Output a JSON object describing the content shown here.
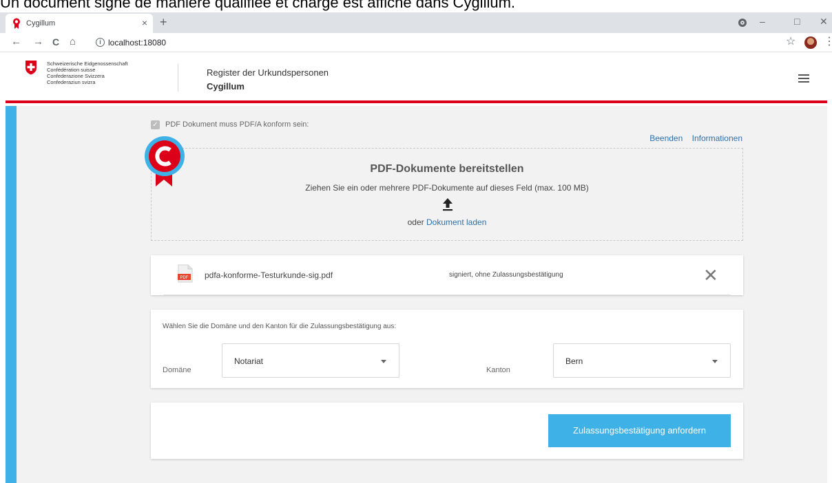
{
  "caption": "Un document signé de manière qualifiée et chargé est affiché dans Cygillum.",
  "browser": {
    "tab_title": "Cygillum",
    "tab_close": "×",
    "new_tab": "+",
    "url": "localhost:18080",
    "nav": {
      "back": "←",
      "forward": "→",
      "reload": "C",
      "home": "⌂"
    },
    "info_glyph": "i",
    "star": "☆",
    "menu": "⋮",
    "window": {
      "minimize": "–",
      "maximize": "□",
      "close": "✕"
    },
    "icons": [
      "cygillum-favicon-icon",
      "extension-icon",
      "star-icon",
      "profile-avatar-icon",
      "kebab-menu-icon"
    ]
  },
  "header": {
    "federal_lines": [
      "Schweizerische Eidgenossenschaft",
      "Confédération suisse",
      "Confederazione Svizzera",
      "Confederaziun svizra"
    ],
    "register_title": "Register der Urkundspersonen",
    "app_name": "Cygillum",
    "accent_color": "#dc0018"
  },
  "options": {
    "pdfa_checkbox_label": "PDF Dokument muss PDF/A konform sein:",
    "pdfa_checked": true,
    "checkmark": "✓"
  },
  "links": {
    "quit": "Beenden",
    "info": "Informationen"
  },
  "dropzone": {
    "title": "PDF-Dokumente bereitstellen",
    "description": "Ziehen Sie ein oder mehrere PDF-Dokumente auf dieses Feld (max. 100 MB)",
    "or_prefix": "oder",
    "load_link": "Dokument laden"
  },
  "file": {
    "name": "pdfa-konforme-Testurkunde-sig.pdf",
    "status": "signiert, ohne Zulassungsbestätigung",
    "remove": "✕",
    "icon_text": "PDF"
  },
  "selection": {
    "heading": "Wählen Sie die Domäne und den Kanton für die Zulassungsbestätigung aus:",
    "domain_label": "Domäne",
    "domain_value": "Notariat",
    "canton_label": "Kanton",
    "canton_value": "Bern"
  },
  "actions": {
    "request_button": "Zulassungsbestätigung anfordern"
  },
  "colors": {
    "primary": "#3eb1e6",
    "link": "#2f6fa8",
    "background": "#f2f2f2"
  }
}
